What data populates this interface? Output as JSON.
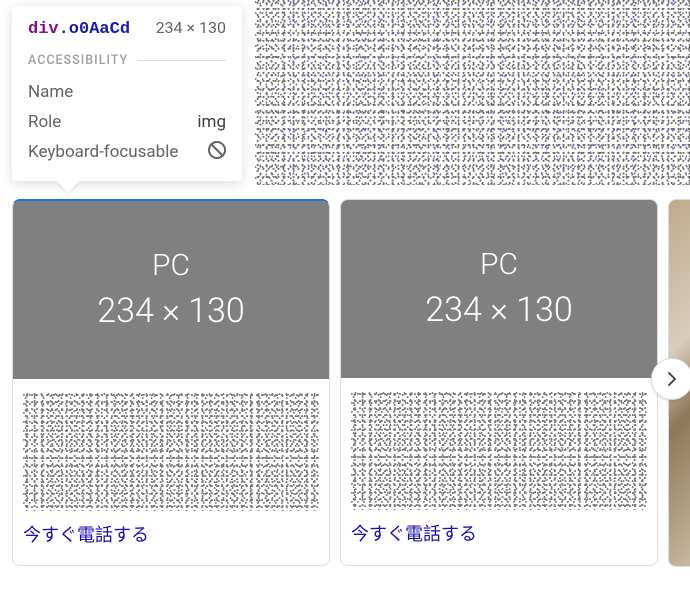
{
  "tooltip": {
    "tag": "div",
    "class_name": ".o0AaCd",
    "dimensions": "234 × 130",
    "section_label": "ACCESSIBILITY",
    "rows": {
      "name": {
        "key": "Name",
        "val": ""
      },
      "role": {
        "key": "Role",
        "val": "img"
      },
      "focusable": {
        "key": "Keyboard-focusable"
      }
    }
  },
  "cards": [
    {
      "placeholder_label": "PC",
      "placeholder_dims": "234 × 130",
      "link_text": "今すぐ電話する"
    },
    {
      "placeholder_label": "PC",
      "placeholder_dims": "234 × 130",
      "link_text": "今すぐ電話する"
    }
  ],
  "colors": {
    "link": "#1a0dab",
    "accent": "#1a73e8",
    "placeholder_bg": "#808080"
  }
}
